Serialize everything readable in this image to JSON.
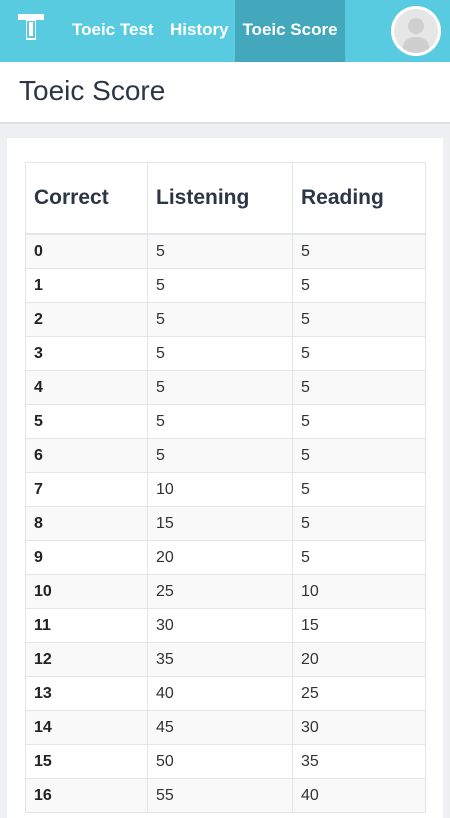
{
  "nav": {
    "items": [
      "Toeic Test",
      "History",
      "Toeic Score"
    ],
    "active_index": 2
  },
  "page": {
    "title": "Toeic Score"
  },
  "table": {
    "columns": [
      "Correct",
      "Listening",
      "Reading"
    ],
    "rows": [
      [
        "0",
        "5",
        "5"
      ],
      [
        "1",
        "5",
        "5"
      ],
      [
        "2",
        "5",
        "5"
      ],
      [
        "3",
        "5",
        "5"
      ],
      [
        "4",
        "5",
        "5"
      ],
      [
        "5",
        "5",
        "5"
      ],
      [
        "6",
        "5",
        "5"
      ],
      [
        "7",
        "10",
        "5"
      ],
      [
        "8",
        "15",
        "5"
      ],
      [
        "9",
        "20",
        "5"
      ],
      [
        "10",
        "25",
        "10"
      ],
      [
        "11",
        "30",
        "15"
      ],
      [
        "12",
        "35",
        "20"
      ],
      [
        "13",
        "40",
        "25"
      ],
      [
        "14",
        "45",
        "30"
      ],
      [
        "15",
        "50",
        "35"
      ],
      [
        "16",
        "55",
        "40"
      ]
    ]
  },
  "colors": {
    "navbar": "#58cbe0",
    "nav_active": "#43a8bb",
    "title": "#2c3645"
  },
  "icons": {
    "logo": "toeic-logo-icon",
    "avatar": "user-avatar-icon"
  }
}
